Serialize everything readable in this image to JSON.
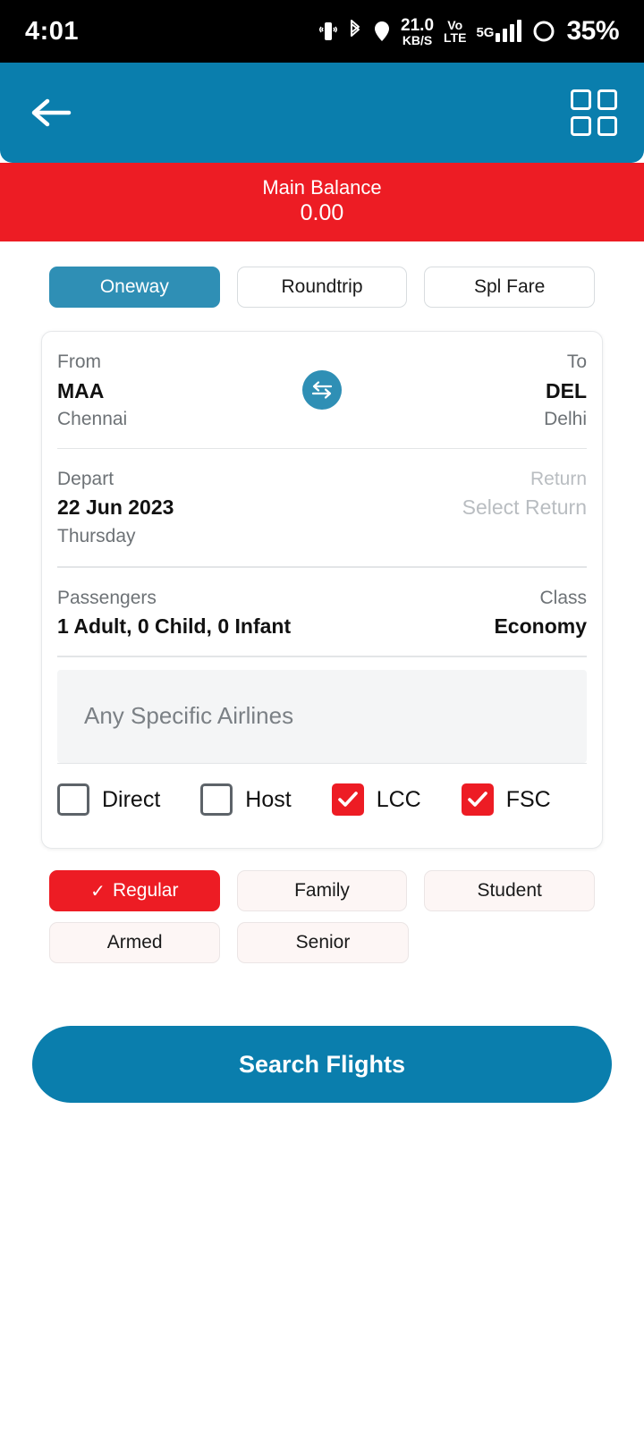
{
  "status_bar": {
    "time": "4:01",
    "data_rate": "21.0",
    "data_unit": "KB/S",
    "volte_top": "Vo",
    "volte_bottom": "LTE",
    "network": "5G",
    "battery": "35%",
    "icons": [
      "vibrate-icon",
      "bluetooth-icon",
      "location-icon",
      "signal-bars-icon",
      "battery-icon"
    ]
  },
  "header": {
    "back_icon": "arrow-left-icon",
    "grid_icon": "grid-menu-icon"
  },
  "balance": {
    "label": "Main Balance",
    "amount": "0.00",
    "color": "#ed1c24"
  },
  "trip_tabs": [
    {
      "label": "Oneway",
      "active": true
    },
    {
      "label": "Roundtrip",
      "active": false
    },
    {
      "label": "Spl Fare",
      "active": false
    }
  ],
  "search_form": {
    "from": {
      "label": "From",
      "code": "MAA",
      "city": "Chennai"
    },
    "to": {
      "label": "To",
      "code": "DEL",
      "city": "Delhi"
    },
    "swap_icon": "swap-horizontal-icon",
    "depart": {
      "label": "Depart",
      "date": "22 Jun 2023",
      "day": "Thursday"
    },
    "return": {
      "label": "Return",
      "value": "Select Return"
    },
    "passengers": {
      "label": "Passengers",
      "value": "1 Adult, 0 Child, 0 Infant"
    },
    "class": {
      "label": "Class",
      "value": "Economy"
    },
    "airlines": {
      "placeholder": "Any Specific Airlines",
      "value": ""
    },
    "filters": [
      {
        "label": "Direct",
        "checked": false
      },
      {
        "label": "Host",
        "checked": false
      },
      {
        "label": "LCC",
        "checked": true
      },
      {
        "label": "FSC",
        "checked": true
      }
    ]
  },
  "fare_types_row1": [
    {
      "label": "Regular",
      "active": true,
      "tick": "✓"
    },
    {
      "label": "Family",
      "active": false,
      "tick": ""
    },
    {
      "label": "Student",
      "active": false,
      "tick": ""
    }
  ],
  "fare_types_row2": [
    {
      "label": "Armed",
      "active": false,
      "tick": ""
    },
    {
      "label": "Senior",
      "active": false,
      "tick": ""
    }
  ],
  "search_button": {
    "label": "Search Flights",
    "color": "#0a7ead"
  },
  "theme": {
    "primary_blue": "#0a7ead",
    "tab_blue": "#2f8fb5",
    "red": "#ed1c24"
  }
}
